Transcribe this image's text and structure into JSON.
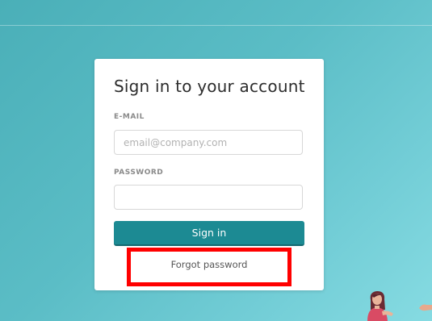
{
  "login": {
    "title": "Sign in to your account",
    "email_label": "E-MAIL",
    "email_placeholder": "email@company.com",
    "email_value": "",
    "password_label": "PASSWORD",
    "password_value": "",
    "signin_label": "Sign in",
    "forgot_label": "Forgot password"
  },
  "colors": {
    "background_start": "#4aafb8",
    "background_end": "#86dbe2",
    "signin_button": "#1c8a93",
    "highlight_box": "#ff0000"
  },
  "decorations": {
    "illustration": "person-illustration",
    "hand_icon": "hand-illustration"
  }
}
